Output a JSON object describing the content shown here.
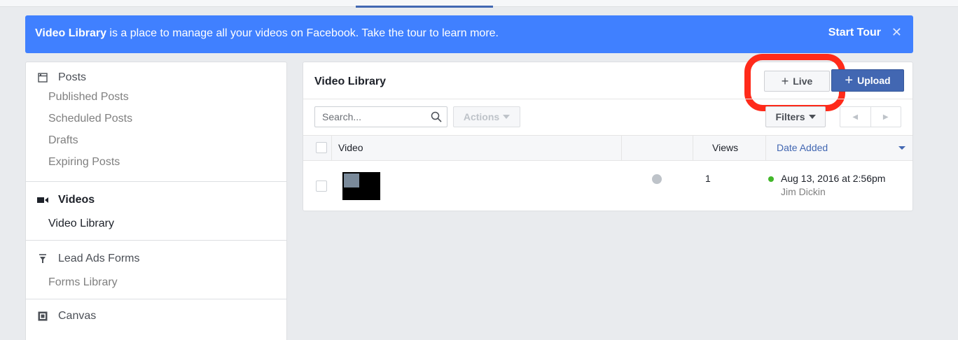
{
  "banner": {
    "title_bold": "Video Library",
    "text": " is a place to manage all your videos on Facebook. Take the tour to learn more.",
    "start_tour": "Start Tour",
    "close": "✕"
  },
  "sidebar": {
    "sections": [
      {
        "label": "Posts",
        "icon": "posts-icon",
        "items": [
          "Published Posts",
          "Scheduled Posts",
          "Drafts",
          "Expiring Posts"
        ]
      },
      {
        "label": "Videos",
        "icon": "video-camera-icon",
        "items": [
          "Video Library"
        ]
      },
      {
        "label": "Lead Ads Forms",
        "icon": "funnel-icon",
        "items": [
          "Forms Library"
        ]
      },
      {
        "label": "Canvas",
        "icon": "canvas-icon",
        "items": []
      }
    ]
  },
  "library": {
    "title": "Video Library",
    "live_button": "Live",
    "upload_button": "Upload",
    "search_placeholder": "Search...",
    "actions_button": "Actions",
    "filters_button": "Filters",
    "columns": {
      "video": "Video",
      "views": "Views",
      "date_added": "Date Added"
    },
    "rows": [
      {
        "views": "1",
        "date_added": "Aug 13, 2016 at 2:56pm",
        "author": "Jim Dickin",
        "status": "published"
      }
    ]
  },
  "colors": {
    "banner": "#4080ff",
    "primary": "#4267b2",
    "highlight": "#ff2a1a",
    "status_published": "#42b72a"
  }
}
